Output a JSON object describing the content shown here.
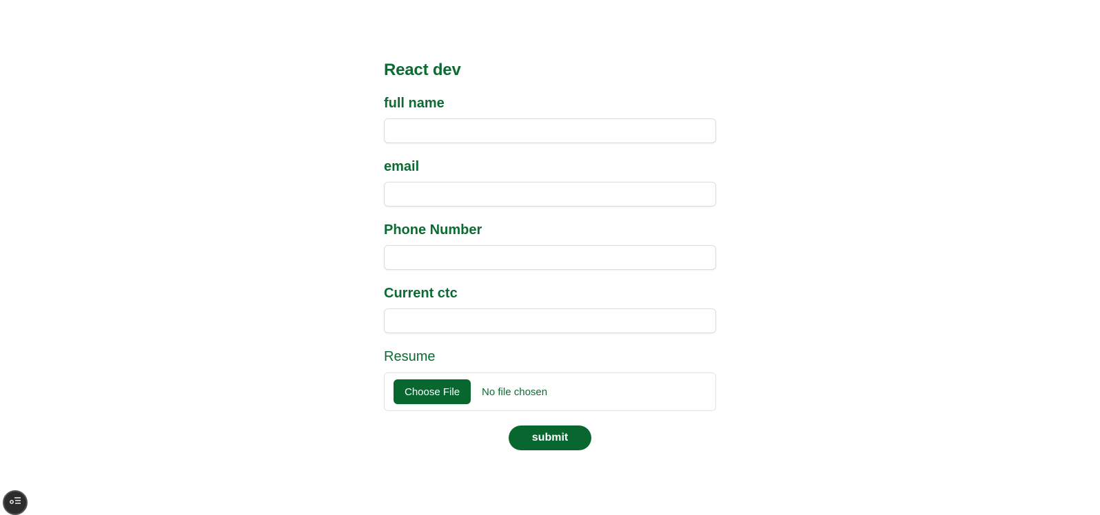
{
  "form": {
    "title": "React dev",
    "fields": [
      {
        "label": "full name",
        "value": "",
        "placeholder": ""
      },
      {
        "label": "email",
        "value": "",
        "placeholder": ""
      },
      {
        "label": "Phone Number",
        "value": "",
        "placeholder": ""
      },
      {
        "label": "Current ctc",
        "value": "",
        "placeholder": ""
      }
    ],
    "resume": {
      "label": "Resume",
      "button_label": "Choose File",
      "status": "No file chosen"
    },
    "submit_label": "submit"
  },
  "colors": {
    "accent": "#08662f",
    "text": "#0b6b32"
  },
  "corner_widget": {
    "icon": "list-settings-icon"
  }
}
